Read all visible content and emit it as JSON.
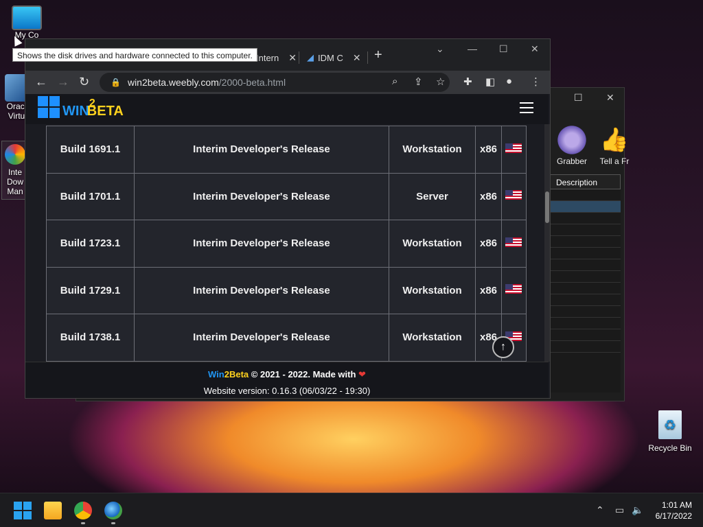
{
  "desktop": {
    "icons": [
      {
        "label": "My Co"
      },
      {
        "label": "Oracl Virtu"
      },
      {
        "label": "Inte Dow Man"
      },
      {
        "label": "Recycle Bin"
      }
    ],
    "tooltip": "Shows the disk drives and hardware connected to this computer."
  },
  "idm": {
    "tools": [
      {
        "label": "Grabber"
      },
      {
        "label": "Tell a Fr"
      }
    ],
    "column_header": "Description"
  },
  "browser": {
    "tabs": [
      {
        "label": "Intern"
      },
      {
        "label": "IDM C"
      }
    ],
    "url_host": "win2beta.weebly.com",
    "url_path": "/2000-beta.html",
    "site": {
      "logo_win": "WIN",
      "logo_two": "2",
      "logo_beta": "BETA"
    },
    "builds": [
      {
        "build": "Build 1691.1",
        "type": "Interim Developer's Release",
        "edition": "Workstation",
        "arch": "x86"
      },
      {
        "build": "Build 1701.1",
        "type": "Interim Developer's Release",
        "edition": "Server",
        "arch": "x86"
      },
      {
        "build": "Build 1723.1",
        "type": "Interim Developer's Release",
        "edition": "Workstation",
        "arch": "x86"
      },
      {
        "build": "Build 1729.1",
        "type": "Interim Developer's Release",
        "edition": "Workstation",
        "arch": "x86"
      },
      {
        "build": "Build 1738.1",
        "type": "Interim Developer's Release",
        "edition": "Workstation",
        "arch": "x86"
      }
    ],
    "footer": {
      "w": "Win",
      "b": "2Beta",
      "copy": " © 2021 - 2022. Made with ",
      "version": "Website version: 0.16.3 (06/03/22 - 19:30)"
    }
  },
  "taskbar": {
    "time": "1:01 AM",
    "date": "6/17/2022"
  }
}
